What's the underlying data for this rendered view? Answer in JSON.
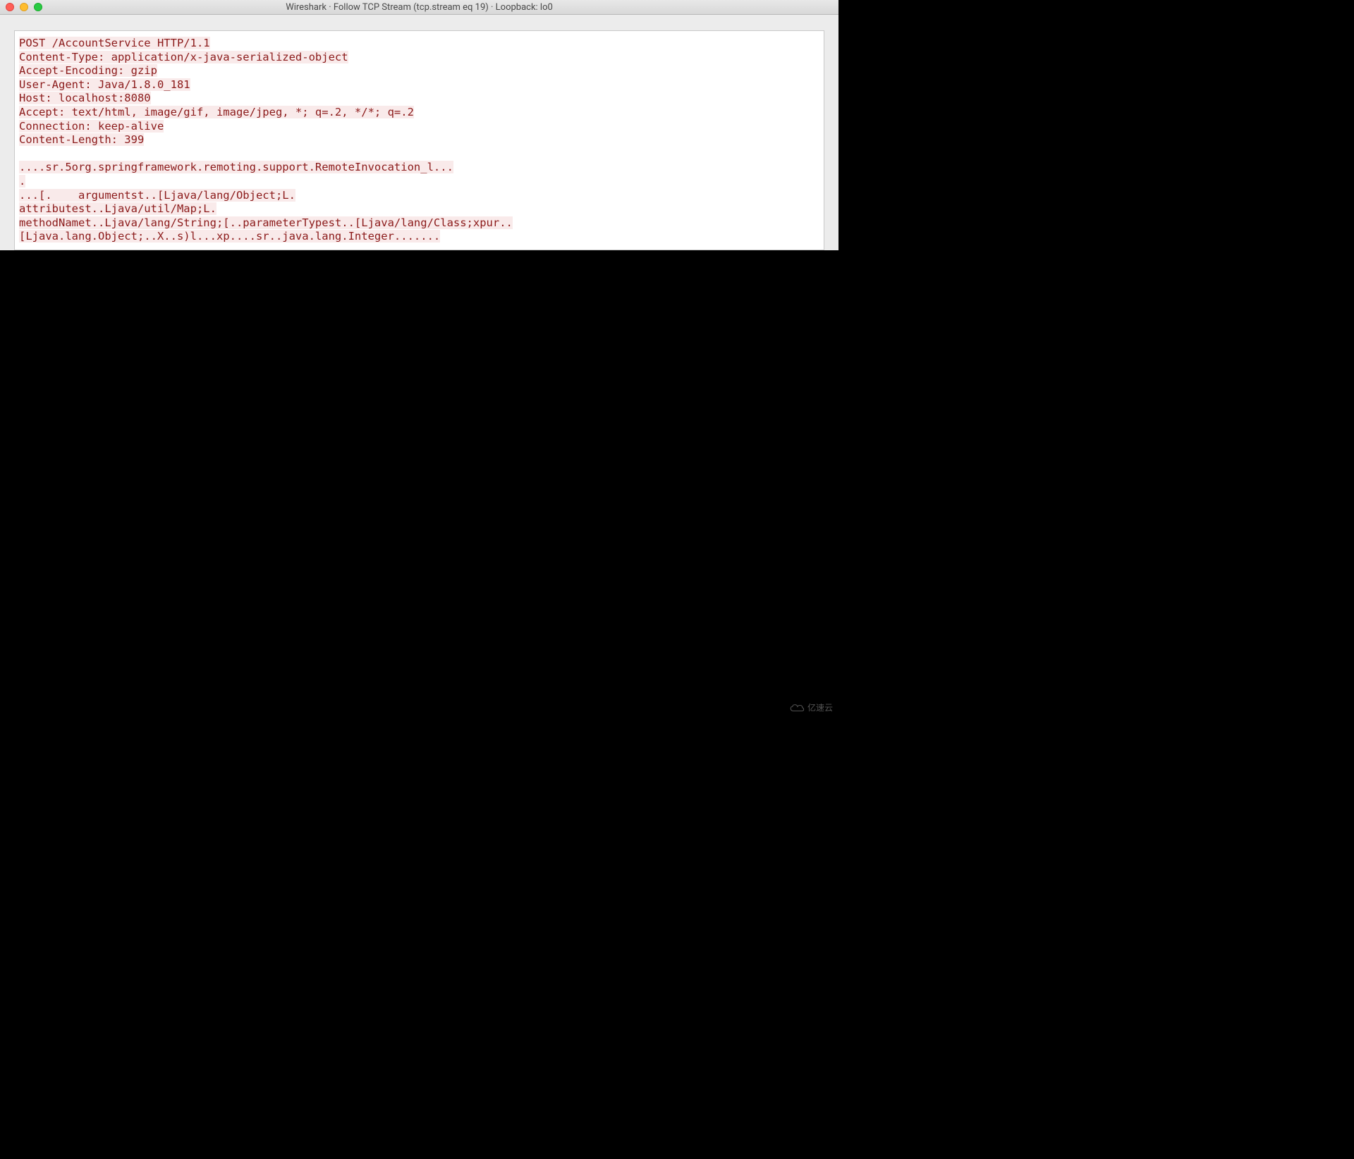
{
  "titlebar": {
    "title": "Wireshark · Follow TCP Stream (tcp.stream eq 19) · Loopback: lo0"
  },
  "stream": {
    "lines": [
      "POST /AccountService HTTP/1.1",
      "Content-Type: application/x-java-serialized-object",
      "Accept-Encoding: gzip",
      "User-Agent: Java/1.8.0_181",
      "Host: localhost:8080",
      "Accept: text/html, image/gif, image/jpeg, *; q=.2, */*; q=.2",
      "Connection: keep-alive",
      "Content-Length: 399",
      "",
      "....sr.5org.springframework.remoting.support.RemoteInvocation_l...",
      ".",
      "...[.    argumentst..[Ljava/lang/Object;L.",
      "attributest..Ljava/util/Map;L.",
      "methodNamet..Ljava/lang/String;[..parameterTypest..[Ljava/lang/Class;xpur..",
      "[Ljava.lang.Object;..X..s)l...xp....sr..java.lang.Integer......."
    ]
  },
  "watermark": {
    "text": "亿速云"
  }
}
